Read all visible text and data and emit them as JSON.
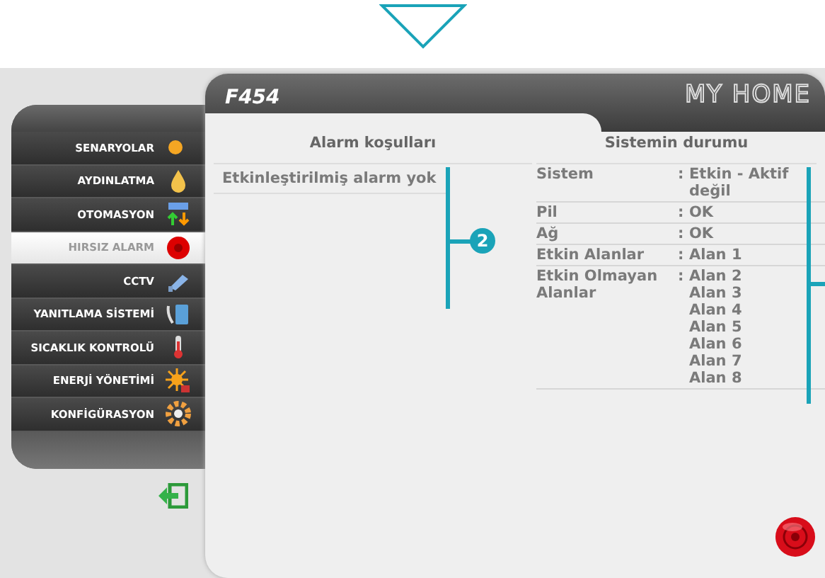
{
  "header": {
    "model": "F454",
    "brand": "MY HOME"
  },
  "menu": [
    {
      "label": "SENARYOLAR",
      "selected": false
    },
    {
      "label": "AYDINLATMA",
      "selected": false
    },
    {
      "label": "OTOMASYON",
      "selected": false
    },
    {
      "label": "HIRSIZ ALARM",
      "selected": true
    },
    {
      "label": "CCTV",
      "selected": false
    },
    {
      "label": "YANITLAMA SİSTEMİ",
      "selected": false
    },
    {
      "label": "SICAKLIK KONTROLÜ",
      "selected": false
    },
    {
      "label": "ENERJİ YÖNETİMİ",
      "selected": false
    },
    {
      "label": "KONFİGÜRASYON",
      "selected": false
    }
  ],
  "alarm_panel": {
    "heading": "Alarm koşulları",
    "message": "Etkinleştirilmiş alarm yok"
  },
  "status_panel": {
    "heading": "Sistemin durumu",
    "rows": [
      {
        "label": "Sistem",
        "separator": ":",
        "values": [
          "Etkin - Aktif değil"
        ]
      },
      {
        "label": "Pil",
        "separator": ":",
        "values": [
          "OK"
        ]
      },
      {
        "label": "Ağ",
        "separator": ":",
        "values": [
          "OK"
        ]
      },
      {
        "label": "Etkin Alanlar",
        "separator": ":",
        "values": [
          "Alan 1"
        ]
      },
      {
        "label": "Etkin Olmayan Alanlar",
        "separator": ":",
        "values": [
          "Alan 2",
          "Alan 3",
          "Alan 4",
          "Alan 5",
          "Alan 6",
          "Alan 7",
          "Alan 8"
        ]
      }
    ]
  },
  "callout": {
    "badge": "2"
  }
}
